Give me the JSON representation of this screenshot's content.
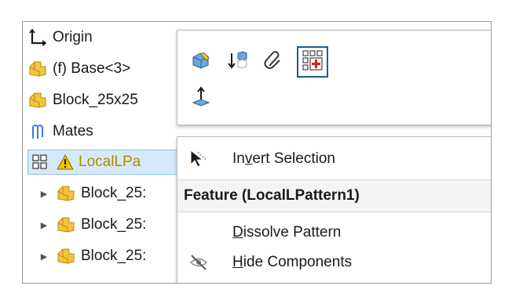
{
  "tree": {
    "items": [
      {
        "label": "Origin",
        "icon": "origin-icon"
      },
      {
        "label": "(f) Base<3>",
        "icon": "part-icon"
      },
      {
        "label": "Block_25x25",
        "icon": "part-icon"
      },
      {
        "label": "Mates",
        "icon": "mates-icon"
      },
      {
        "label": "LocalLPa",
        "icon": "pattern-icon",
        "warning": "warning-icon",
        "selected": true
      },
      {
        "label": "Block_25:",
        "icon": "part-icon",
        "expander": "▶"
      },
      {
        "label": "Block_25:",
        "icon": "part-icon",
        "expander": "▶"
      },
      {
        "label": "Block_25:",
        "icon": "part-icon",
        "expander": "▶"
      }
    ]
  },
  "toolbar": {
    "buttons": [
      {
        "icon": "edit-part-icon"
      },
      {
        "icon": "insert-component-icon"
      },
      {
        "icon": "attach-icon"
      },
      {
        "icon": "edit-pattern-icon",
        "active": true
      },
      {
        "icon": "origin-direction-icon"
      }
    ]
  },
  "menu": {
    "invert_selection": {
      "pre": "In",
      "mn": "v",
      "post": "ert Selection"
    },
    "header": "Feature (LocalLPattern1)",
    "dissolve_pattern": {
      "mn": "D",
      "post": "issolve Pattern"
    },
    "hide_components": {
      "mn": "H",
      "post": "ide Components"
    }
  },
  "colors": {
    "selection_bg": "#d6e9f8",
    "selection_border": "#8cc0e8",
    "warning_text": "#b08a00",
    "active_button_border": "#1f5a8c"
  }
}
